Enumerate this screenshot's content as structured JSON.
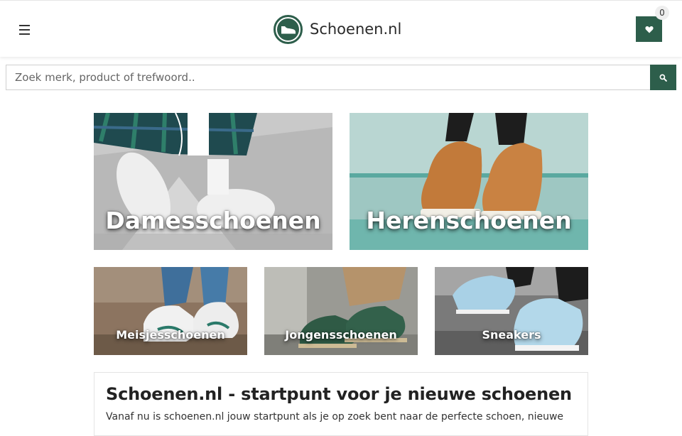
{
  "header": {
    "brand": "Schoenen.nl",
    "wishlist_count": "0"
  },
  "search": {
    "placeholder": "Zoek merk, product of trefwoord.."
  },
  "categories": {
    "dames": "Damesschoenen",
    "heren": "Herenschoenen",
    "meisjes": "Meisjesschoenen",
    "jongens": "Jongensschoenen",
    "sneakers": "Sneakers"
  },
  "info": {
    "title": "Schoenen.nl - startpunt voor je nieuwe schoenen",
    "text": "Vanaf nu is schoenen.nl jouw startpunt als je op zoek bent naar de perfecte schoen, nieuwe"
  },
  "colors": {
    "brand_green": "#2d5e4b"
  },
  "icons": {
    "menu": "hamburger-menu-icon",
    "logo": "shoe-logo-icon",
    "wishlist": "heart-icon",
    "search": "search-icon"
  }
}
